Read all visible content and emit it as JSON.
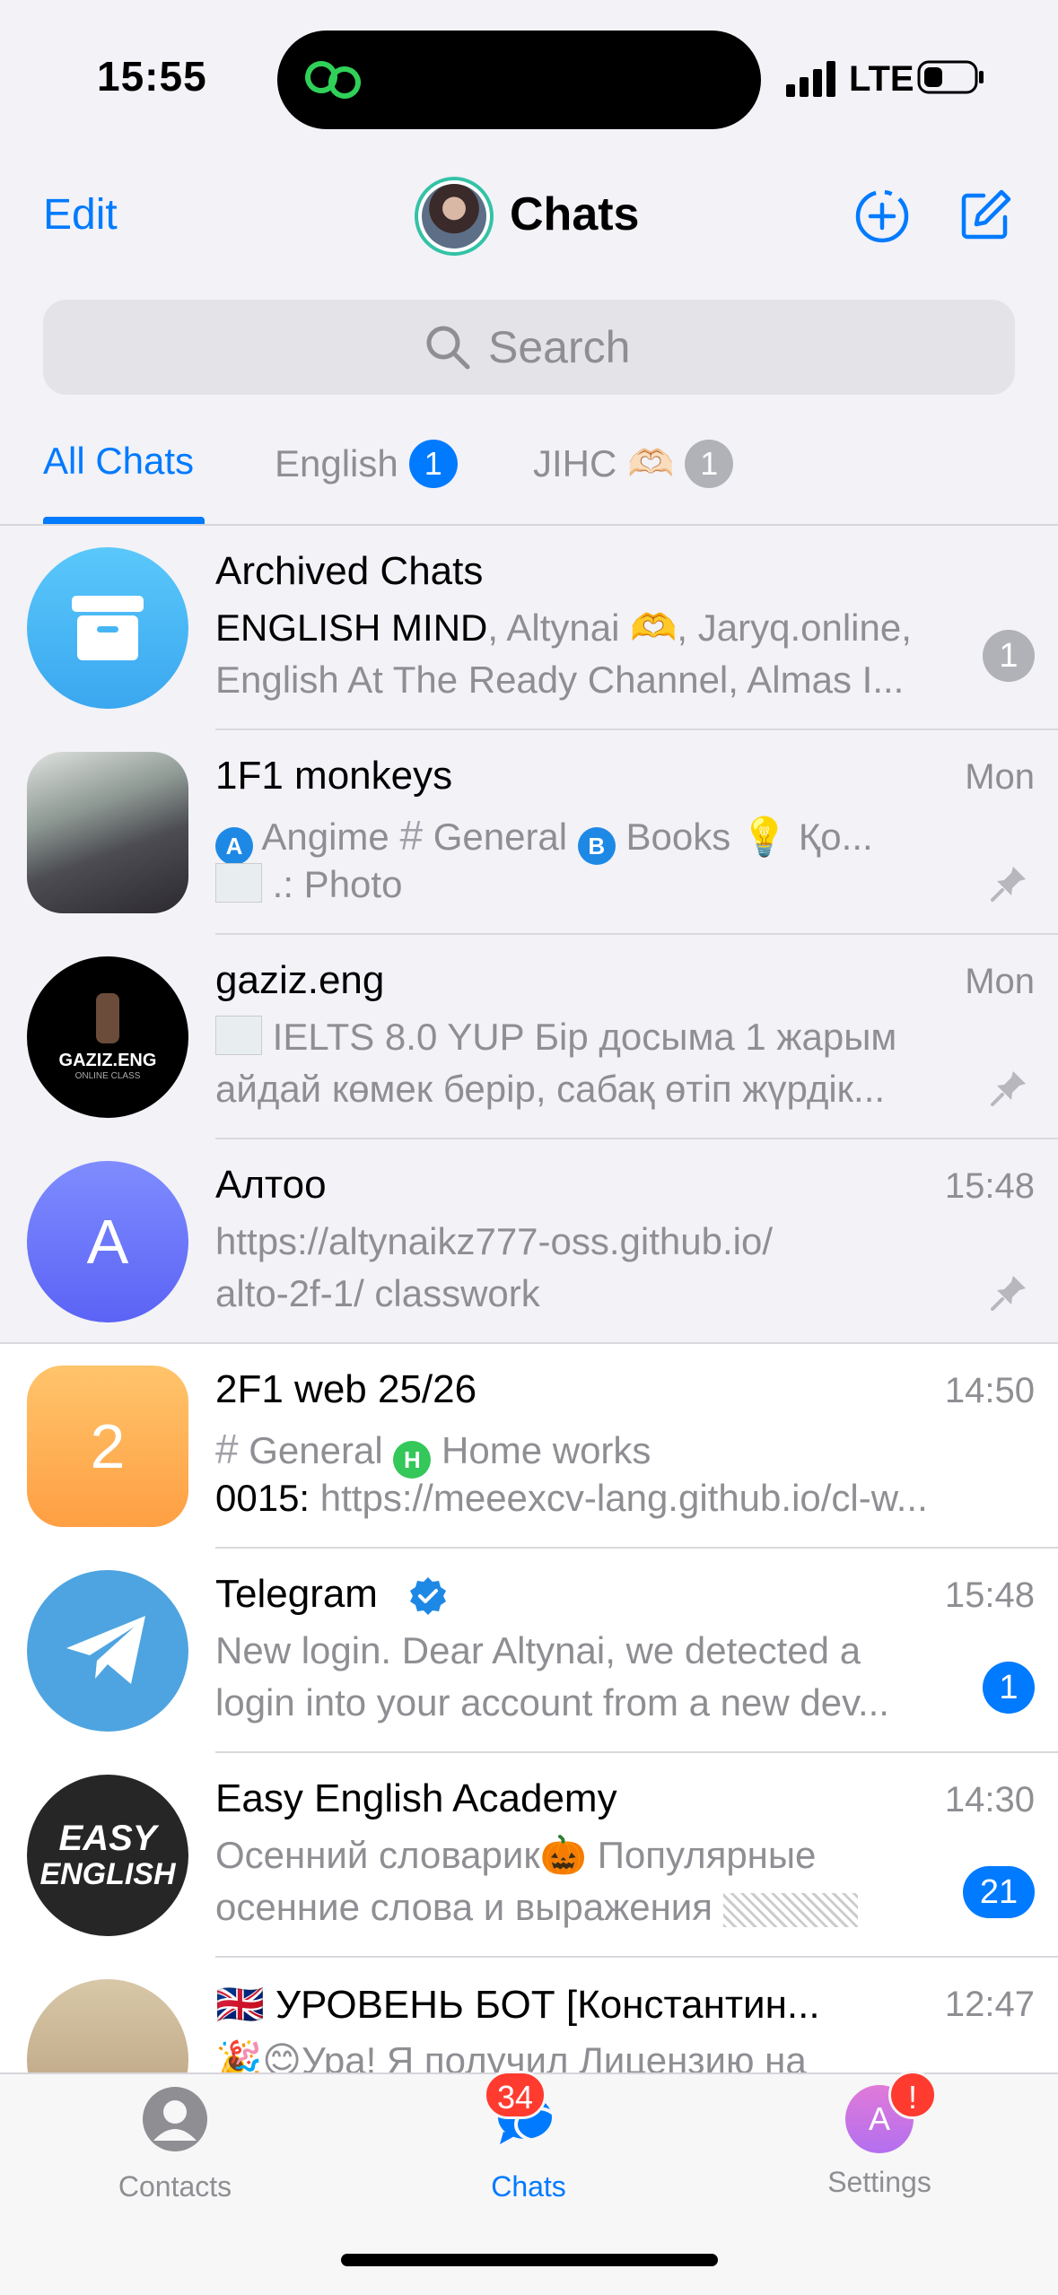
{
  "status_bar": {
    "time": "15:55",
    "network": "LTE"
  },
  "nav": {
    "edit_label": "Edit",
    "title": "Chats"
  },
  "search": {
    "placeholder": "Search"
  },
  "folders": [
    {
      "label": "All Chats"
    },
    {
      "label": "English",
      "badge": "1"
    },
    {
      "label": "JIHC 🫶🏻",
      "badge": "1"
    }
  ],
  "chats": {
    "archived": {
      "title": "Archived Chats",
      "line1_bold": "ENGLISH MIND",
      "line1_rest": ", Altynai 🫶, Jaryq.online,",
      "line2": "English At The Ready Channel, Almas I...",
      "badge": "1"
    },
    "monkeys": {
      "title": "1F1 monkeys",
      "time": "Mon",
      "topic_a_letter": "A",
      "topic_a": "Angime",
      "topic_general": "General",
      "topic_b_letter": "B",
      "topic_b": "Books",
      "topic_more": "💡 Қо...",
      "line2": ".: Photo"
    },
    "gaziz": {
      "title": "gaziz.eng",
      "time": "Mon",
      "avatar_text": "GAZIZ.ENG",
      "avatar_sub": "ONLINE CLASS",
      "line1": "IELTS 8.0 YUP Бір досыма 1 жарым",
      "line2": "айдай көмек берір, сабақ өтіп жүрдік..."
    },
    "altoo": {
      "title": "Алтоо",
      "time": "15:48",
      "avatar_letter": "A",
      "line1": "https://altynaikz777-oss.github.io/",
      "line2": "alto-2f-1/ classwork"
    },
    "web": {
      "title": "2F1 web 25/26",
      "time": "14:50",
      "avatar_letter": "2",
      "line1_topic": "General",
      "line1_h": "H",
      "line1_rest": "Home works",
      "line2_sender": "0015: ",
      "line2": "https://meeexcv-lang.github.io/cl-w..."
    },
    "telegram": {
      "title": "Telegram",
      "time": "15:48",
      "line1": "New login. Dear Altynai, we detected a",
      "line2": "login into your account from a new dev...",
      "badge": "1"
    },
    "easy": {
      "title": "Easy English Academy",
      "time": "14:30",
      "avatar_line1": "EASY",
      "avatar_line2": "ENGLISH",
      "line1": "Осенний словарик🎃 Популярные",
      "line2": "осенние слова и выражения",
      "badge": "21"
    },
    "bot": {
      "title": "🇬🇧 УРОВЕНЬ БОТ [Константин...",
      "time": "12:47",
      "line1": "🎉😊Ура! Я получил Лицензию на"
    }
  },
  "tabbar": {
    "contacts": "Contacts",
    "chats": "Chats",
    "chats_badge": "34",
    "settings": "Settings",
    "settings_badge": "!",
    "settings_avatar_letter": "A"
  },
  "colors": {
    "accent": "#007aff",
    "unread_grey": "#b1b1b8",
    "badge_red": "#ff3b30"
  }
}
